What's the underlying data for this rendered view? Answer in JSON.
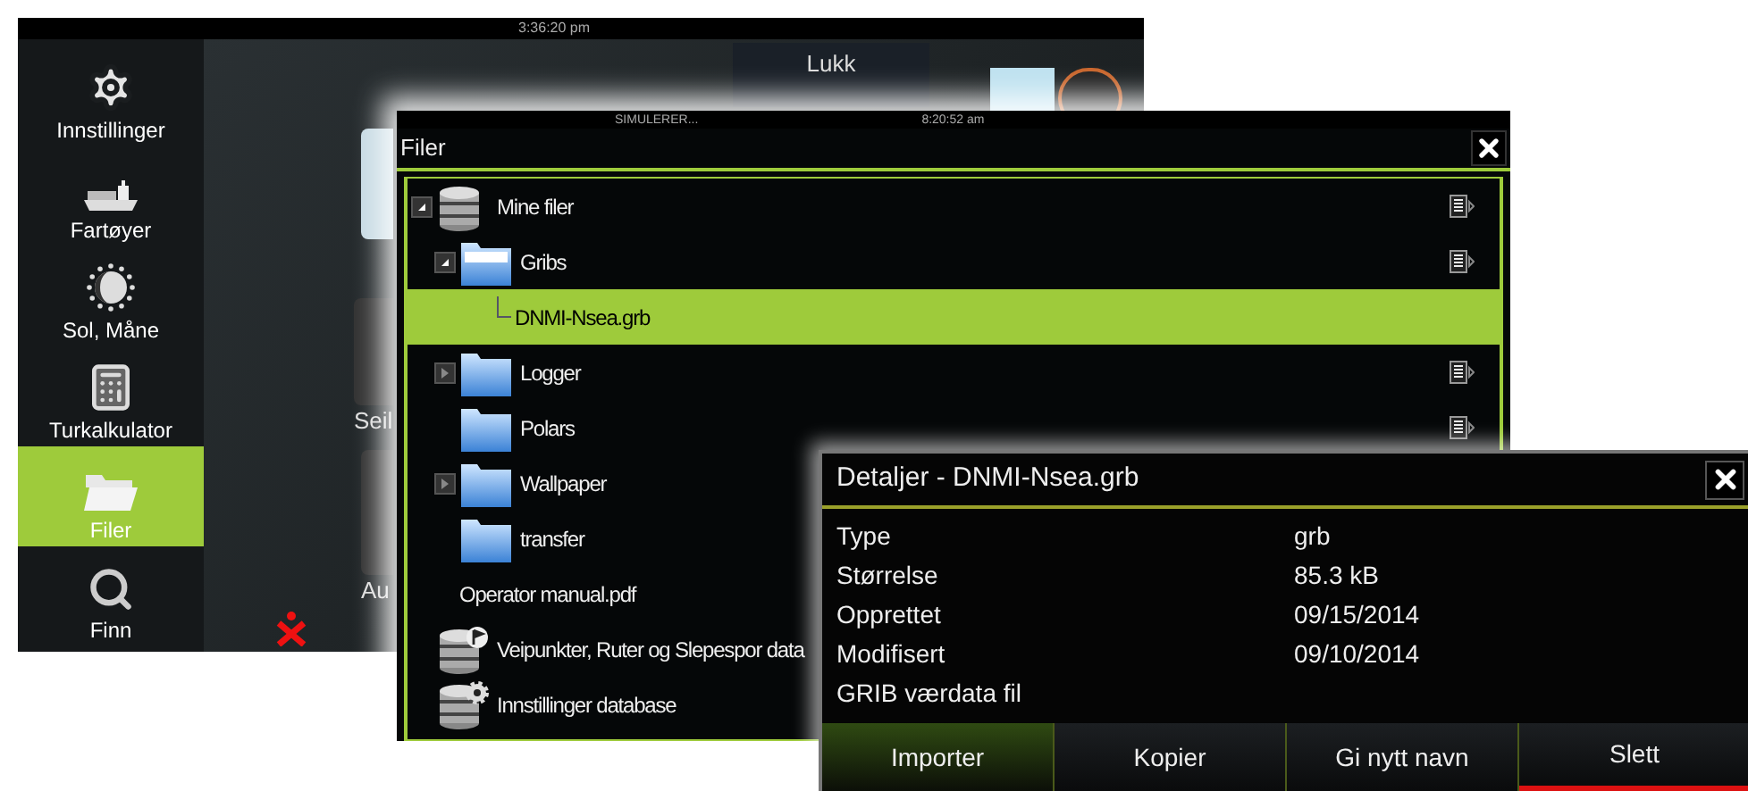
{
  "back_screen": {
    "status_time": "3:36:20 pm",
    "sidebar": [
      {
        "label": "Innstillinger",
        "kind": "settings",
        "selected": false
      },
      {
        "label": "Fartøyer",
        "kind": "vessels",
        "selected": false
      },
      {
        "label": "Sol, Måne",
        "kind": "sunmoon",
        "selected": false
      },
      {
        "label": "Turkalkulator",
        "kind": "calculator",
        "selected": false
      },
      {
        "label": "Filer",
        "kind": "files",
        "selected": true
      },
      {
        "label": "Finn",
        "kind": "find",
        "selected": false
      }
    ],
    "close_button": "Lukk",
    "tiles": [
      "Seil",
      "Au"
    ]
  },
  "files_screen": {
    "status": "SIMULERER...",
    "time": "8:20:52 am",
    "title": "Filer",
    "tree": [
      {
        "label": "Mine filer",
        "kind": "database",
        "expanded": true,
        "selected": false,
        "children": [
          {
            "label": "Gribs",
            "kind": "folder",
            "expanded": true,
            "selected": false,
            "children": [
              {
                "label": "DNMI-Nsea.grb",
                "kind": "file",
                "selected": true
              }
            ]
          },
          {
            "label": "Logger",
            "kind": "folder",
            "expanded": false,
            "selected": false
          },
          {
            "label": "Polars",
            "kind": "folder",
            "selected": false
          },
          {
            "label": "Wallpaper",
            "kind": "folder",
            "expanded": false,
            "selected": false
          },
          {
            "label": "transfer",
            "kind": "folder",
            "selected": false
          },
          {
            "label": "Operator manual.pdf",
            "kind": "document",
            "selected": false
          }
        ]
      },
      {
        "label": "Veipunkter, Ruter og Slepespor data",
        "kind": "waypoints",
        "selected": false
      },
      {
        "label": "Innstillinger database",
        "kind": "settings-db",
        "selected": false
      }
    ]
  },
  "details_dialog": {
    "title": "Detaljer - DNMI-Nsea.grb",
    "rows": [
      {
        "label": "Type",
        "value": "grb"
      },
      {
        "label": "Størrelse",
        "value": "85.3 kB"
      },
      {
        "label": "Opprettet",
        "value": "09/15/2014"
      },
      {
        "label": "Modifisert",
        "value": "09/10/2014"
      },
      {
        "label": "GRIB værdata fil"
      }
    ],
    "buttons": [
      {
        "label": "Importer",
        "selected": true,
        "kind": "normal"
      },
      {
        "label": "Kopier",
        "selected": false,
        "kind": "normal"
      },
      {
        "label": "Gi nytt navn",
        "selected": false,
        "kind": "normal"
      },
      {
        "label": "Slett",
        "selected": false,
        "kind": "destructive"
      }
    ]
  }
}
